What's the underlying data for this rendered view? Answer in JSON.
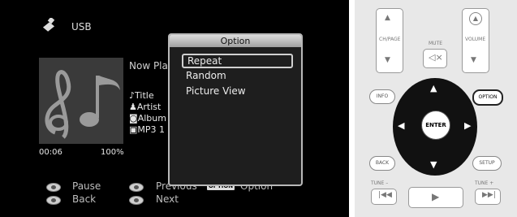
{
  "screen": {
    "source_label": "USB",
    "now_playing_label": "Now Pla",
    "meta": {
      "title": "Title",
      "artist": "Artist",
      "album": "Album",
      "format": "MP3 1"
    },
    "elapsed": "00:06",
    "progress_percent": "100%",
    "footer": {
      "pause_label": "Pause",
      "previous_label": "Previous",
      "option_tag": "OPTION",
      "option_label": "Option",
      "back_label": "Back",
      "next_label": "Next"
    },
    "popup": {
      "title": "Option",
      "items": [
        "Repeat",
        "Random",
        "Picture View"
      ],
      "selected": "Repeat"
    }
  },
  "remote": {
    "ch_page_label": "CH/PAGE",
    "mute_label": "MUTE",
    "volume_label": "VOLUME",
    "info_label": "INFO",
    "option_label": "OPTION",
    "enter_label": "ENTER",
    "back_label": "BACK",
    "setup_label": "SETUP",
    "tune_minus_label": "TUNE –",
    "tune_plus_label": "TUNE +"
  },
  "colors": {
    "screen_bg": "#000000",
    "popup_header": "#c4c4c4",
    "remote_body": "#e8e8e8"
  },
  "icons": [
    "usb-icon",
    "music-note-icon",
    "title-note-icon",
    "artist-icon",
    "album-icon",
    "file-icon",
    "play-icon",
    "skip-back-icon",
    "skip-forward-icon",
    "mute-icon",
    "volume-icon"
  ]
}
